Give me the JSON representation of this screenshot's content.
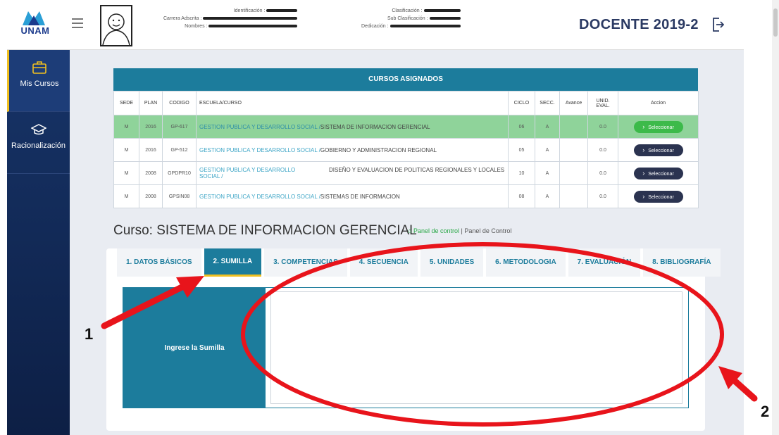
{
  "header": {
    "logo_text": "UNAM",
    "info_left": [
      {
        "label": "Identificación :"
      },
      {
        "label": "Carrera Adscrita :"
      },
      {
        "label": "Nombres :"
      }
    ],
    "info_right": [
      {
        "label": "Clasificación :"
      },
      {
        "label": "Sub Clasificación :"
      },
      {
        "label": "Dedicación :"
      }
    ],
    "title": "DOCENTE 2019-2"
  },
  "sidebar": {
    "items": [
      {
        "label": "Mis Cursos",
        "icon": "briefcase-icon"
      },
      {
        "label": "Racionalización",
        "icon": "graduation-cap-icon"
      }
    ]
  },
  "courses": {
    "heading": "CURSOS ASIGNADOS",
    "columns": [
      "SEDE",
      "PLAN",
      "CODIGO",
      "ESCUELA/CURSO",
      "CICLO",
      "SECC.",
      "Avance",
      "UNID. EVAL.",
      "Accion"
    ],
    "rows": [
      {
        "sede": "M",
        "plan": "2016",
        "codigo": "GP-617",
        "escuela": "GESTION PUBLICA Y DESARROLLO SOCIAL /",
        "curso": "SISTEMA DE INFORMACION GERENCIAL",
        "ciclo": "06",
        "secc": "A",
        "avance": "",
        "unid": "0.0",
        "accion": "Seleccionar"
      },
      {
        "sede": "M",
        "plan": "2016",
        "codigo": "GP-512",
        "escuela": "GESTION PUBLICA Y DESARROLLO SOCIAL /",
        "curso": "GOBIERNO Y ADMINISTRACION REGIONAL",
        "ciclo": "05",
        "secc": "A",
        "avance": "",
        "unid": "0.0",
        "accion": "Seleccionar"
      },
      {
        "sede": "M",
        "plan": "2008",
        "codigo": "GPDPR10",
        "escuela": "GESTION PUBLICA Y DESARROLLO SOCIAL /",
        "curso": "DISEÑO Y EVALUACION DE POLITICAS REGIONALES Y LOCALES",
        "ciclo": "10",
        "secc": "A",
        "avance": "",
        "unid": "0.0",
        "accion": "Seleccionar"
      },
      {
        "sede": "M",
        "plan": "2008",
        "codigo": "GPSIN08",
        "escuela": "GESTION PUBLICA Y DESARROLLO SOCIAL /",
        "curso": "SISTEMAS DE INFORMACION",
        "ciclo": "08",
        "secc": "A",
        "avance": "",
        "unid": "0.0",
        "accion": "Seleccionar"
      }
    ]
  },
  "curso": {
    "title": "Curso: SISTEMA DE INFORMACION GERENCIAL",
    "breadcrumb_home": "Panel de control",
    "breadcrumb_sep": "|",
    "breadcrumb_current": "Panel de Control"
  },
  "tabs": [
    {
      "label": "1. DATOS BÁSICOS"
    },
    {
      "label": "2. SUMILLA"
    },
    {
      "label": "3. COMPETENCIAS"
    },
    {
      "label": "4. SECUENCIA"
    },
    {
      "label": "5. UNIDADES"
    },
    {
      "label": "6. METODOLOGIA"
    },
    {
      "label": "7. EVALUACIÓN"
    },
    {
      "label": "8. BIBLIOGRAFÍA"
    }
  ],
  "form": {
    "label": "Ingrese la Sumilla",
    "value": ""
  },
  "annotations": {
    "marker_1": "1",
    "marker_2": "2"
  },
  "colors": {
    "primary": "#1c7c9c",
    "sidebar": "#173468",
    "selected_row": "#8fd39a",
    "accent": "#f0c020",
    "annotation": "#e8141b"
  }
}
